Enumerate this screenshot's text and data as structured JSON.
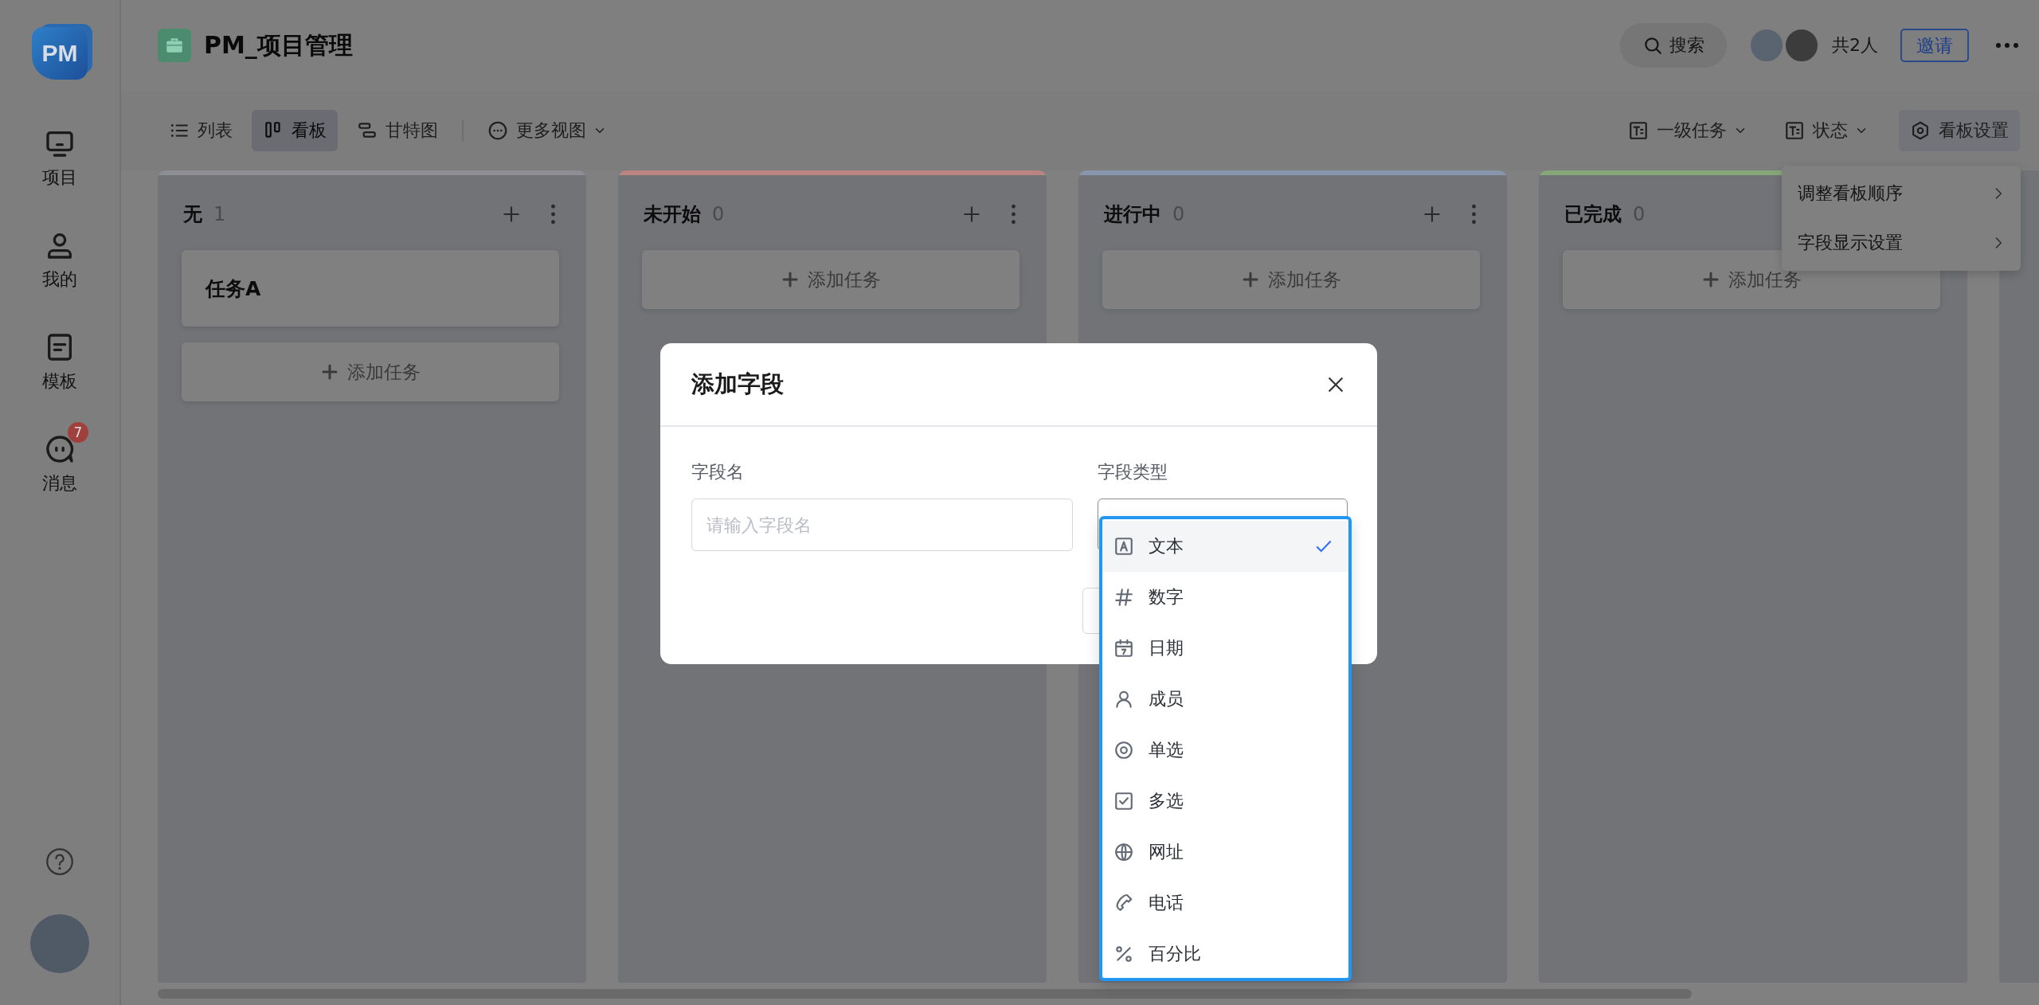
{
  "sidebar": {
    "logo": "PM",
    "items": [
      {
        "label": "项目"
      },
      {
        "label": "我的"
      },
      {
        "label": "模板"
      },
      {
        "label": "消息",
        "badge": "7"
      }
    ]
  },
  "header": {
    "title": "PM_项目管理",
    "search": "搜索",
    "members": "共2人",
    "invite": "邀请"
  },
  "views": [
    {
      "label": "列表",
      "selected": false
    },
    {
      "label": "看板",
      "selected": true
    },
    {
      "label": "甘特图",
      "selected": false
    }
  ],
  "more_views": "更多视图",
  "filters": [
    {
      "label": "一级任务"
    },
    {
      "label": "状态"
    }
  ],
  "board_settings": "看板设置",
  "settings_menu": [
    "调整看板顺序",
    "字段显示设置"
  ],
  "columns": [
    {
      "name": "无",
      "count": "1",
      "color": "#8d8e93",
      "cards": [
        {
          "title": "任务A"
        }
      ],
      "add_label": "添加任务"
    },
    {
      "name": "未开始",
      "count": "0",
      "color": "#b98482",
      "add_label": "添加任务"
    },
    {
      "name": "进行中",
      "count": "0",
      "color": "#8796ad",
      "add_label": "添加任务"
    },
    {
      "name": "已完成",
      "count": "0",
      "color": "#86a878",
      "add_label": "添加任务"
    }
  ],
  "dialog": {
    "title": "添加字段",
    "name_label": "字段名",
    "name_placeholder": "请输入字段名",
    "type_label": "字段类型",
    "type_options": [
      {
        "label": "文本",
        "selected": true
      },
      {
        "label": "数字",
        "selected": false
      },
      {
        "label": "日期",
        "selected": false
      },
      {
        "label": "成员",
        "selected": false
      },
      {
        "label": "单选",
        "selected": false
      },
      {
        "label": "多选",
        "selected": false
      },
      {
        "label": "网址",
        "selected": false
      },
      {
        "label": "电话",
        "selected": false
      },
      {
        "label": "百分比",
        "selected": false
      }
    ]
  }
}
